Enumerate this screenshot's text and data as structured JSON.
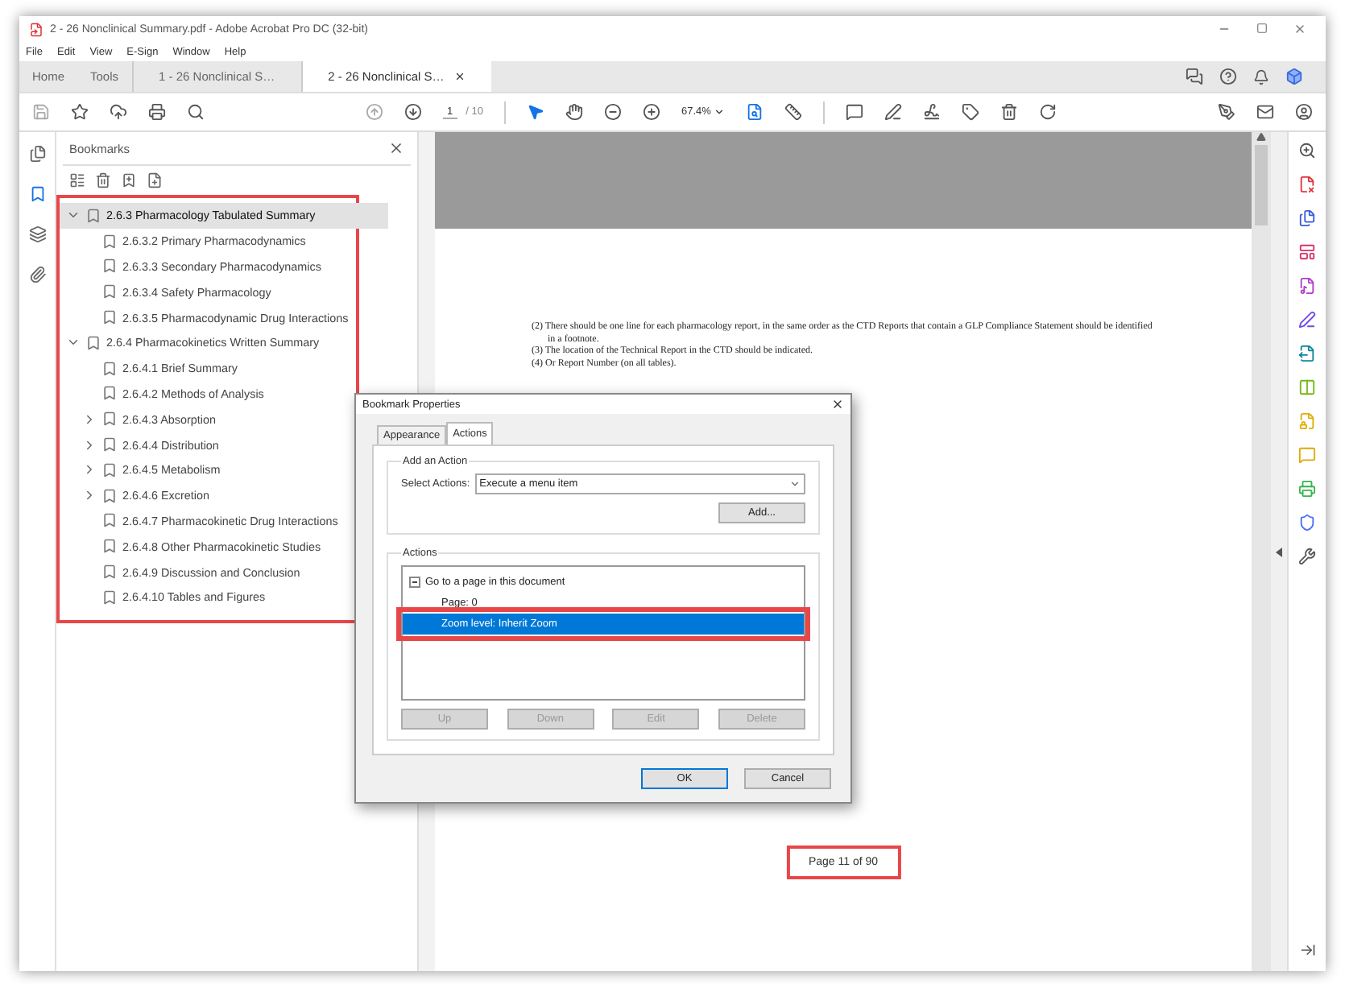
{
  "window": {
    "title": "2 - 26 Nonclinical Summary.pdf - Adobe Acrobat Pro DC (32-bit)"
  },
  "menu": [
    "File",
    "Edit",
    "View",
    "E-Sign",
    "Window",
    "Help"
  ],
  "tabs": [
    {
      "label": "Home",
      "kind": "nav",
      "selected": false
    },
    {
      "label": "Tools",
      "kind": "nav",
      "selected": false
    },
    {
      "label": "1 - 26 Nonclinical S…",
      "kind": "document",
      "selected": false
    },
    {
      "label": "2 - 26 Nonclinical S…",
      "kind": "document",
      "selected": true
    }
  ],
  "toolbar": {
    "page": "1",
    "page_count": "/ 10",
    "zoom": "67.4%"
  },
  "bookmarks": {
    "title": "Bookmarks",
    "highlight": true,
    "items": [
      {
        "label": "2.6.3 Pharmacology Tabulated Summary",
        "selected": true,
        "expanded": true,
        "children": [
          {
            "label": "2.6.3.2 Primary Pharmacodynamics",
            "selected": false
          },
          {
            "label": "2.6.3.3 Secondary Pharmacodynamics",
            "selected": false
          },
          {
            "label": "2.6.3.4 Safety Pharmacology",
            "selected": false
          },
          {
            "label": "2.6.3.5 Pharmacodynamic Drug Interactions",
            "selected": false
          }
        ]
      },
      {
        "label": "2.6.4 Pharmacokinetics Written Summary",
        "selected": false,
        "expanded": true,
        "children": [
          {
            "label": "2.6.4.1 Brief Summary",
            "selected": false
          },
          {
            "label": "2.6.4.2 Methods of Analysis",
            "selected": false
          },
          {
            "label": "2.6.4.3 Absorption",
            "selected": false,
            "expanded": false
          },
          {
            "label": "2.6.4.4 Distribution",
            "selected": false,
            "expanded": false
          },
          {
            "label": "2.6.4.5 Metabolism",
            "selected": false,
            "expanded": false
          },
          {
            "label": "2.6.4.6 Excretion",
            "selected": false,
            "expanded": false
          },
          {
            "label": "2.6.4.7 Pharmacokinetic Drug Interactions",
            "selected": false
          },
          {
            "label": "2.6.4.8 Other Pharmacokinetic Studies",
            "selected": false
          },
          {
            "label": "2.6.4.9 Discussion and Conclusion",
            "selected": false
          },
          {
            "label": "2.6.4.10 Tables and Figures",
            "selected": false
          }
        ]
      }
    ]
  },
  "document": {
    "notes": [
      "(2) There should be one line for each pharmacology report, in the same order as the CTD Reports that contain a GLP Compliance Statement should be identified in a footnote.",
      "(3) The location of the Technical Report in the CTD should be indicated.",
      "(4) Or Report Number (on all tables)."
    ],
    "page_label": {
      "text": "Page 11 of 90",
      "highlight": true
    }
  },
  "dialog": {
    "title": "Bookmark Properties",
    "tabs": [
      {
        "label": "Appearance",
        "selected": false
      },
      {
        "label": "Actions",
        "selected": true
      }
    ],
    "add_group": {
      "title": "Add an Action",
      "select_label": "Select Actions:",
      "select_value": "Execute a menu item",
      "add_button": "Add..."
    },
    "actions_group": {
      "title": "Actions",
      "items": [
        {
          "label": "Go to a page in this document",
          "expanded": true,
          "selected": false,
          "children": [
            {
              "label": "Page: 0",
              "selected": false,
              "highlight": false
            },
            {
              "label": "Zoom level: Inherit Zoom",
              "selected": true,
              "highlight": true
            }
          ]
        }
      ],
      "buttons": [
        {
          "label": "Up",
          "disabled": true
        },
        {
          "label": "Down",
          "disabled": true
        },
        {
          "label": "Edit",
          "disabled": true
        },
        {
          "label": "Delete",
          "disabled": true
        }
      ]
    },
    "footer": [
      {
        "label": "OK",
        "default": true
      },
      {
        "label": "Cancel",
        "default": false
      }
    ]
  }
}
